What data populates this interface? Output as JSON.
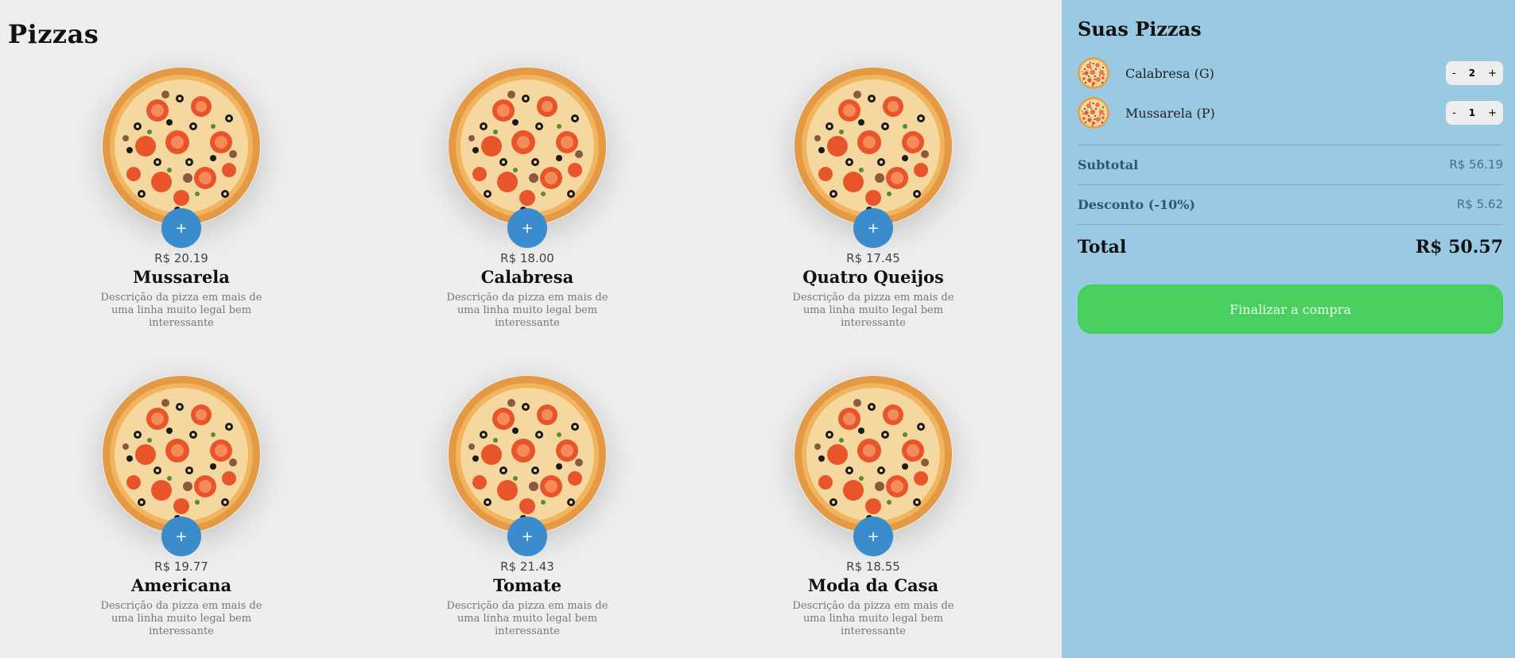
{
  "page_title": "Pizzas",
  "pizzas": [
    {
      "name": "Mussarela",
      "price": "R$ 20.19",
      "description": "Descrição da pizza em mais de uma linha muito legal bem interessante",
      "add_label": "+"
    },
    {
      "name": "Calabresa",
      "price": "R$ 18.00",
      "description": "Descrição da pizza em mais de uma linha muito legal bem interessante",
      "add_label": "+"
    },
    {
      "name": "Quatro Queijos",
      "price": "R$ 17.45",
      "description": "Descrição da pizza em mais de uma linha muito legal bem interessante",
      "add_label": "+"
    },
    {
      "name": "Americana",
      "price": "R$ 19.77",
      "description": "Descrição da pizza em mais de uma linha muito legal bem interessante",
      "add_label": "+"
    },
    {
      "name": "Tomate",
      "price": "R$ 21.43",
      "description": "Descrição da pizza em mais de uma linha muito legal bem interessante",
      "add_label": "+"
    },
    {
      "name": "Moda da Casa",
      "price": "R$ 18.55",
      "description": "Descrição da pizza em mais de uma linha muito legal bem interessante",
      "add_label": "+"
    }
  ],
  "cart": {
    "title": "Suas Pizzas",
    "items": [
      {
        "name": "Calabresa (G)",
        "qty": "2",
        "minus": "-",
        "plus": "+"
      },
      {
        "name": "Mussarela (P)",
        "qty": "1",
        "minus": "-",
        "plus": "+"
      }
    ],
    "subtotal_label": "Subtotal",
    "subtotal_value": "R$ 56.19",
    "discount_label": "Desconto (-10%)",
    "discount_value": "R$ 5.62",
    "total_label": "Total",
    "total_value": "R$ 50.57",
    "checkout_label": "Finalizar a compra"
  },
  "colors": {
    "accent": "#3a8ccc",
    "sidebar_bg": "#9ac9e3",
    "checkout_bg": "#49d060",
    "page_bg": "#eeeeee"
  }
}
